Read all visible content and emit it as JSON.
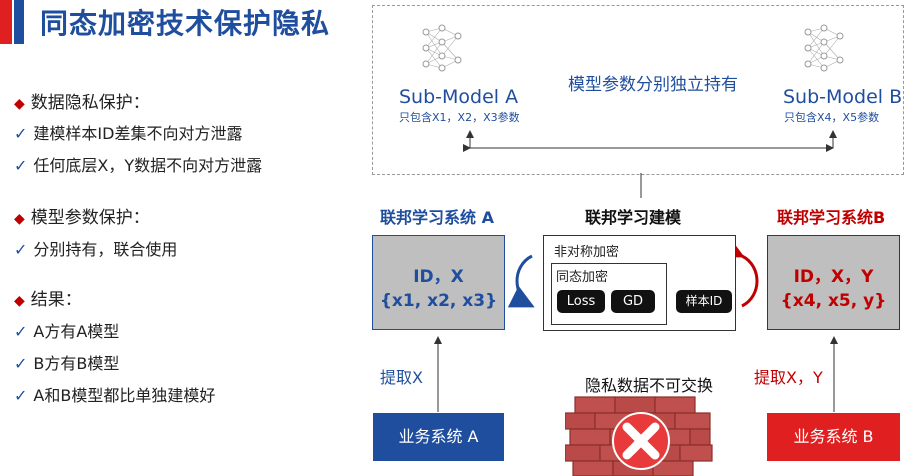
{
  "title": "同态加密技术保护隐私",
  "left": {
    "sections": [
      {
        "heading": "数据隐私保护：",
        "items": [
          "建模样本ID差集不向对方泄露",
          "任何底层X，Y数据不向对方泄露"
        ]
      },
      {
        "heading": "模型参数保护：",
        "items": [
          "分别持有，联合使用"
        ]
      },
      {
        "heading": "结果：",
        "items": [
          "A方有A模型",
          "B方有B模型",
          "A和B模型都比单独建模好"
        ]
      }
    ]
  },
  "top": {
    "model_a": {
      "name": "Sub-Model A",
      "sub": "只包含X1，X2，X3参数"
    },
    "model_b": {
      "name": "Sub-Model B",
      "sub": "只包含X4，X5参数"
    },
    "middle_label": "模型参数分别独立持有"
  },
  "system_a": {
    "header": "联邦学习系统 A",
    "line1": "ID，X",
    "line2": "{x1, x2, x3}",
    "extract": "提取X",
    "business": "业务系统 A"
  },
  "center": {
    "header": "联邦学习建模",
    "asym": "非对称加密",
    "homo": "同态加密",
    "loss": "Loss",
    "gd": "GD",
    "sample_id": "样本ID",
    "warning": "隐私数据不可交换"
  },
  "system_b": {
    "header": "联邦学习系统B",
    "line1": "ID，X，Y",
    "line2": "{x4, x5, y}",
    "extract": "提取X，Y",
    "business": "业务系统 B"
  },
  "colors": {
    "blue": "#1f4e9e",
    "red": "#c00000",
    "gray_box": "#bfbfbf",
    "brick": "#c0504d"
  }
}
